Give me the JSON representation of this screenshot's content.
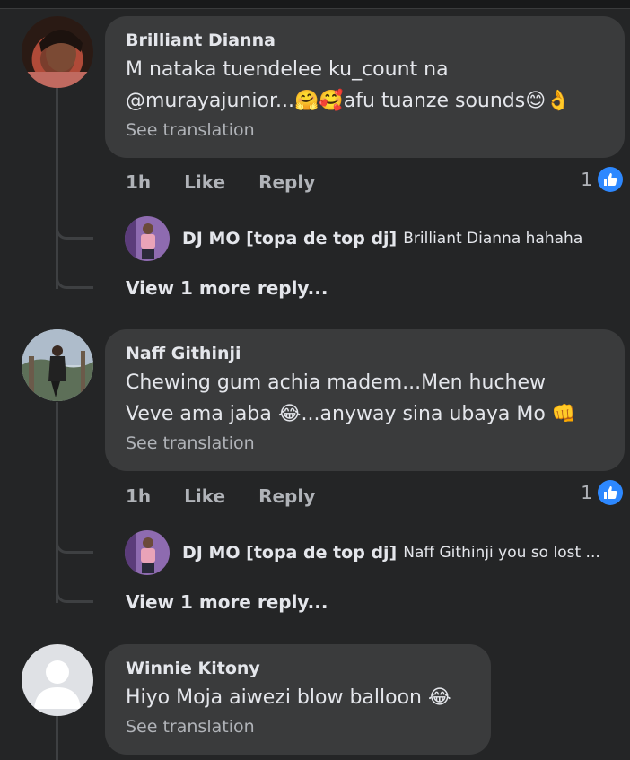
{
  "comments": [
    {
      "author": "Brilliant Dianna",
      "text": "M nataka tuendelee ku_count na\n@murayajunior...🤗🥰afu tuanze sounds😊👌",
      "see_translation": "See translation",
      "time": "1h",
      "like_label": "Like",
      "reply_label": "Reply",
      "reaction_count": "1",
      "reply": {
        "author": "DJ MO [topa de top dj]",
        "text": "Brilliant Dianna hahaha"
      },
      "view_more": "View 1 more reply..."
    },
    {
      "author": "Naff Githinji",
      "text": "Chewing gum achia madem...Men huchew\nVeve ama jaba 😂...anyway sina ubaya Mo 👊",
      "see_translation": "See translation",
      "time": "1h",
      "like_label": "Like",
      "reply_label": "Reply",
      "reaction_count": "1",
      "reply": {
        "author": "DJ MO [topa de top dj]",
        "text": "Naff Githinji  you so lost ..."
      },
      "view_more": "View 1 more reply..."
    },
    {
      "author": "Winnie Kitony",
      "text": "Hiyo Moja aiwezi blow balloon 😂",
      "see_translation": "See translation"
    }
  ],
  "colors": {
    "background": "#242526",
    "bubble": "#3a3b3c",
    "like_blue": "#2d88ff",
    "muted": "#b0b3b8"
  },
  "icons": {
    "like_badge": "thumbs-up-icon",
    "default_avatar": "user-silhouette-icon"
  }
}
